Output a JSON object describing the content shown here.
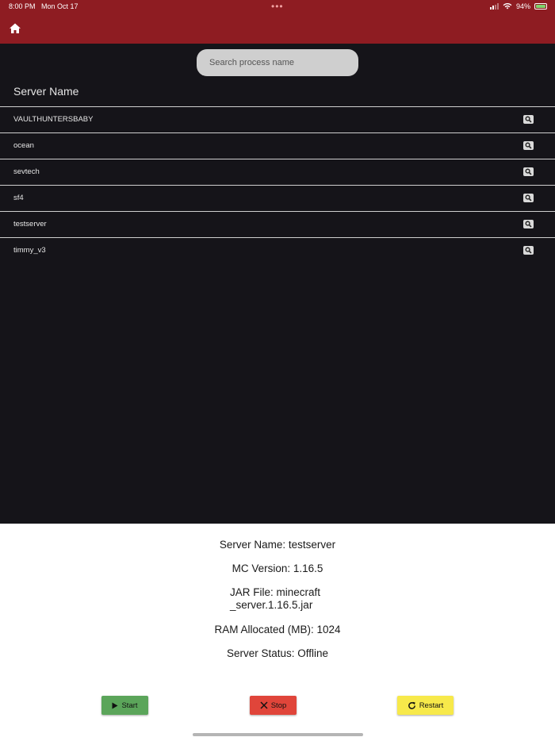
{
  "status_bar": {
    "time": "8:00 PM",
    "date": "Mon Oct 17",
    "battery": "94%",
    "battery_level": 0.94
  },
  "app_bar": {
    "home_icon": "home-icon",
    "color": "#8e1c22"
  },
  "search": {
    "placeholder": "Search process name",
    "value": ""
  },
  "list": {
    "header": "Server Name",
    "search_icon": "magnifier-icon",
    "items": [
      {
        "name": "VAULTHUNTERSBABY"
      },
      {
        "name": "ocean"
      },
      {
        "name": "sevtech"
      },
      {
        "name": "sf4"
      },
      {
        "name": "testserver"
      },
      {
        "name": "timmy_v3"
      }
    ]
  },
  "details": {
    "server_name": "Server Name: testserver",
    "mc_version": "MC Version: 1.16.5",
    "jar_line1": "JAR File: minecraft",
    "jar_line2": "_server.1.16.5.jar",
    "ram": "RAM Allocated (MB): 1024",
    "status": "Server Status: Offline"
  },
  "actions": {
    "start": "Start",
    "stop": "Stop",
    "restart": "Restart",
    "start_color": "#5ba55a",
    "stop_color": "#e0453a",
    "restart_color": "#f7e94a"
  }
}
